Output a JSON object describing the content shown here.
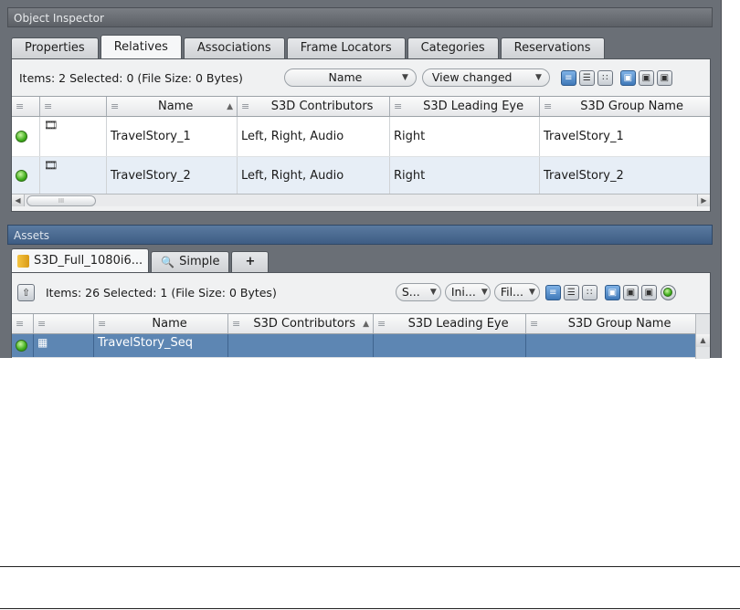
{
  "inspector": {
    "title": "Object Inspector",
    "tabs": [
      "Properties",
      "Relatives",
      "Associations",
      "Frame Locators",
      "Categories",
      "Reservations"
    ],
    "active_tab": "Relatives",
    "items_text": "Items: 2 Selected: 0 (File Size: 0 Bytes)",
    "sort_dropdown": "Name",
    "view_dropdown": "View changed",
    "columns": [
      "Name",
      "S3D Contributors",
      "S3D Leading Eye",
      "S3D Group Name"
    ],
    "rows": [
      {
        "name": "TravelStory_1",
        "contributors": "Left, Right, Audio",
        "leading_eye": "Right",
        "group": "TravelStory_1",
        "status_color": "#3fae1c"
      },
      {
        "name": "TravelStory_2",
        "contributors": "Left, Right, Audio",
        "leading_eye": "Right",
        "group": "TravelStory_2",
        "status_color": "#3fae1c"
      }
    ],
    "scroll_thumb": "III"
  },
  "assets": {
    "title": "Assets",
    "tabs": [
      "S3D_Full_1080i6...",
      "Simple",
      "+"
    ],
    "items_text": "Items: 26 Selected: 1 (File Size: 0 Bytes)",
    "filters": [
      "S...",
      "Ini...",
      "Fil..."
    ],
    "columns": [
      "Name",
      "S3D Contributors",
      "S3D Leading Eye",
      "S3D Group Name"
    ],
    "rows": [
      {
        "name": "TravelStory_Seq",
        "contributors": "",
        "leading_eye": "",
        "group": "",
        "selected": true
      }
    ]
  },
  "colors": {
    "panel_bg": "#6a6f76",
    "title_bar": "#3e5d84",
    "selection": "#5d86b3",
    "status_green": "#3fae1c"
  }
}
